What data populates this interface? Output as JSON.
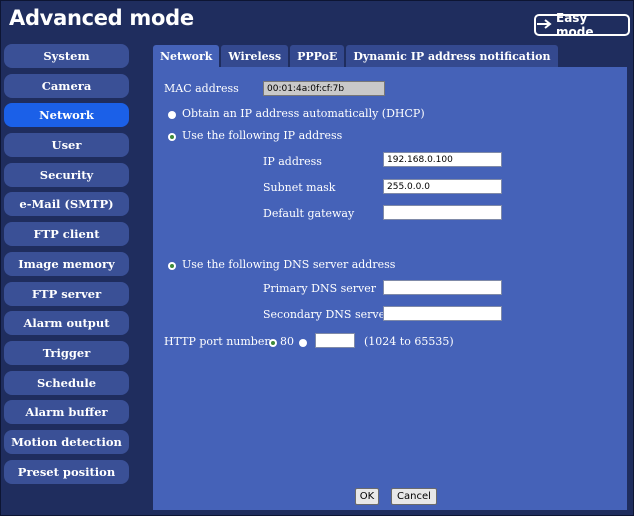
{
  "header": {
    "title": "Advanced mode",
    "easy_mode_label": "Easy mode"
  },
  "sidebar": {
    "items": [
      {
        "label": "System"
      },
      {
        "label": "Camera"
      },
      {
        "label": "Network"
      },
      {
        "label": "User"
      },
      {
        "label": "Security"
      },
      {
        "label": "e-Mail (SMTP)"
      },
      {
        "label": "FTP client"
      },
      {
        "label": "Image memory"
      },
      {
        "label": "FTP server"
      },
      {
        "label": "Alarm output"
      },
      {
        "label": "Trigger"
      },
      {
        "label": "Schedule"
      },
      {
        "label": "Alarm buffer"
      },
      {
        "label": "Motion detection"
      },
      {
        "label": "Preset position"
      }
    ],
    "active": "Network"
  },
  "tabs": [
    {
      "label": "Network"
    },
    {
      "label": "Wireless"
    },
    {
      "label": "PPPoE"
    },
    {
      "label": "Dynamic IP address notification"
    }
  ],
  "form": {
    "mac_label": "MAC address",
    "mac_value": "00:01:4a:0f:cf:7b",
    "dhcp_label": "Obtain an IP address automatically (DHCP)",
    "static_label": "Use the following IP address",
    "ip_label": "IP address",
    "ip_value": "192.168.0.100",
    "subnet_label": "Subnet mask",
    "subnet_value": "255.0.0.0",
    "gateway_label": "Default gateway",
    "gateway_value": "",
    "dns_label": "Use the following DNS server address",
    "primary_dns_label": "Primary DNS server",
    "primary_dns_value": "",
    "secondary_dns_label": "Secondary DNS server",
    "secondary_dns_value": "",
    "http_port_label": "HTTP port number",
    "http_default_label": "80",
    "http_custom_value": "",
    "http_range_label": "(1024 to 65535)"
  },
  "buttons": {
    "ok": "OK",
    "cancel": "Cancel"
  }
}
